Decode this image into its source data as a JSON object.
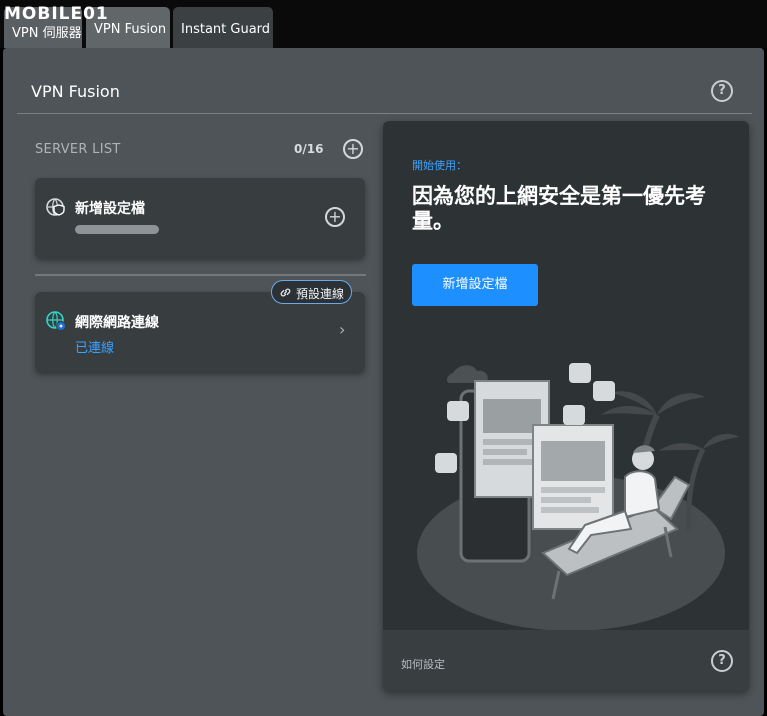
{
  "watermark": {
    "text": "MOBILE01"
  },
  "tabs": [
    {
      "label": "VPN 伺服器"
    },
    {
      "label": "VPN Fusion"
    },
    {
      "label": "Instant Guard"
    }
  ],
  "panel": {
    "title": "VPN Fusion",
    "help_icon": "question-circle-icon"
  },
  "server_list": {
    "label": "SERVER LIST",
    "count": "0/16",
    "add_icon": "plus-circle-icon",
    "add_card": {
      "title": "新增設定檔",
      "icon": "shield-globe-icon"
    },
    "wan_card": {
      "title": "網際網路連線",
      "status": "已連線",
      "status_color": "#3aa3ff",
      "badge": "預設連線",
      "icon": "globe-icon"
    }
  },
  "promo": {
    "kicker": "開始使用：",
    "heading": "因為您的上網安全是第一優先考量。",
    "cta_label": "新增設定檔",
    "cta_color": "#1e8fff",
    "footer_link": "如何設定"
  }
}
